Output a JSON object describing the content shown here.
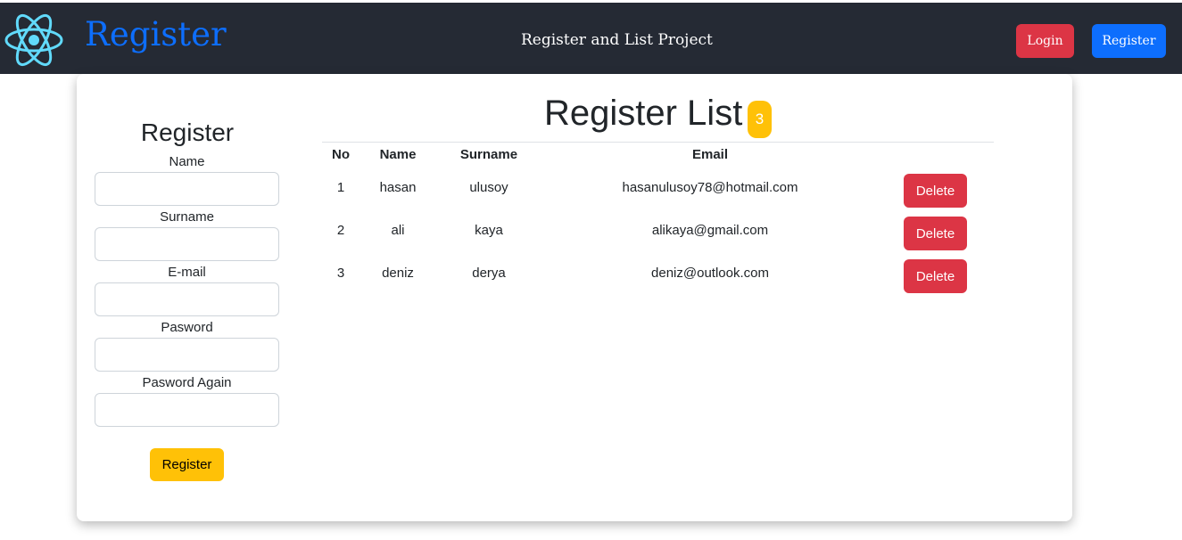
{
  "navbar": {
    "brand": "Register",
    "center_title": "Register and List Project",
    "login_label": "Login",
    "register_label": "Register"
  },
  "form": {
    "title": "Register",
    "fields": [
      {
        "label": "Name",
        "value": ""
      },
      {
        "label": "Surname",
        "value": ""
      },
      {
        "label": "E-mail",
        "value": ""
      },
      {
        "label": "Pasword",
        "value": ""
      },
      {
        "label": "Pasword Again",
        "value": ""
      }
    ],
    "submit_label": "Register"
  },
  "list": {
    "title": "Register List",
    "count": "3",
    "columns": [
      "No",
      "Name",
      "Surname",
      "Email"
    ],
    "rows": [
      {
        "no": "1",
        "name": "hasan",
        "surname": "ulusoy",
        "email": "hasanulusoy78@hotmail.com",
        "action": "Delete"
      },
      {
        "no": "2",
        "name": "ali",
        "surname": "kaya",
        "email": "alikaya@gmail.com",
        "action": "Delete"
      },
      {
        "no": "3",
        "name": "deniz",
        "surname": "derya",
        "email": "deniz@outlook.com",
        "action": "Delete"
      }
    ]
  },
  "colors": {
    "navbar_bg": "#252a34",
    "brand": "#0d6efd",
    "danger": "#dc3545",
    "primary": "#0d6efd",
    "warning": "#ffc107",
    "react_logo": "#61dafb"
  },
  "icons": {
    "logo": "react-atom-icon"
  }
}
